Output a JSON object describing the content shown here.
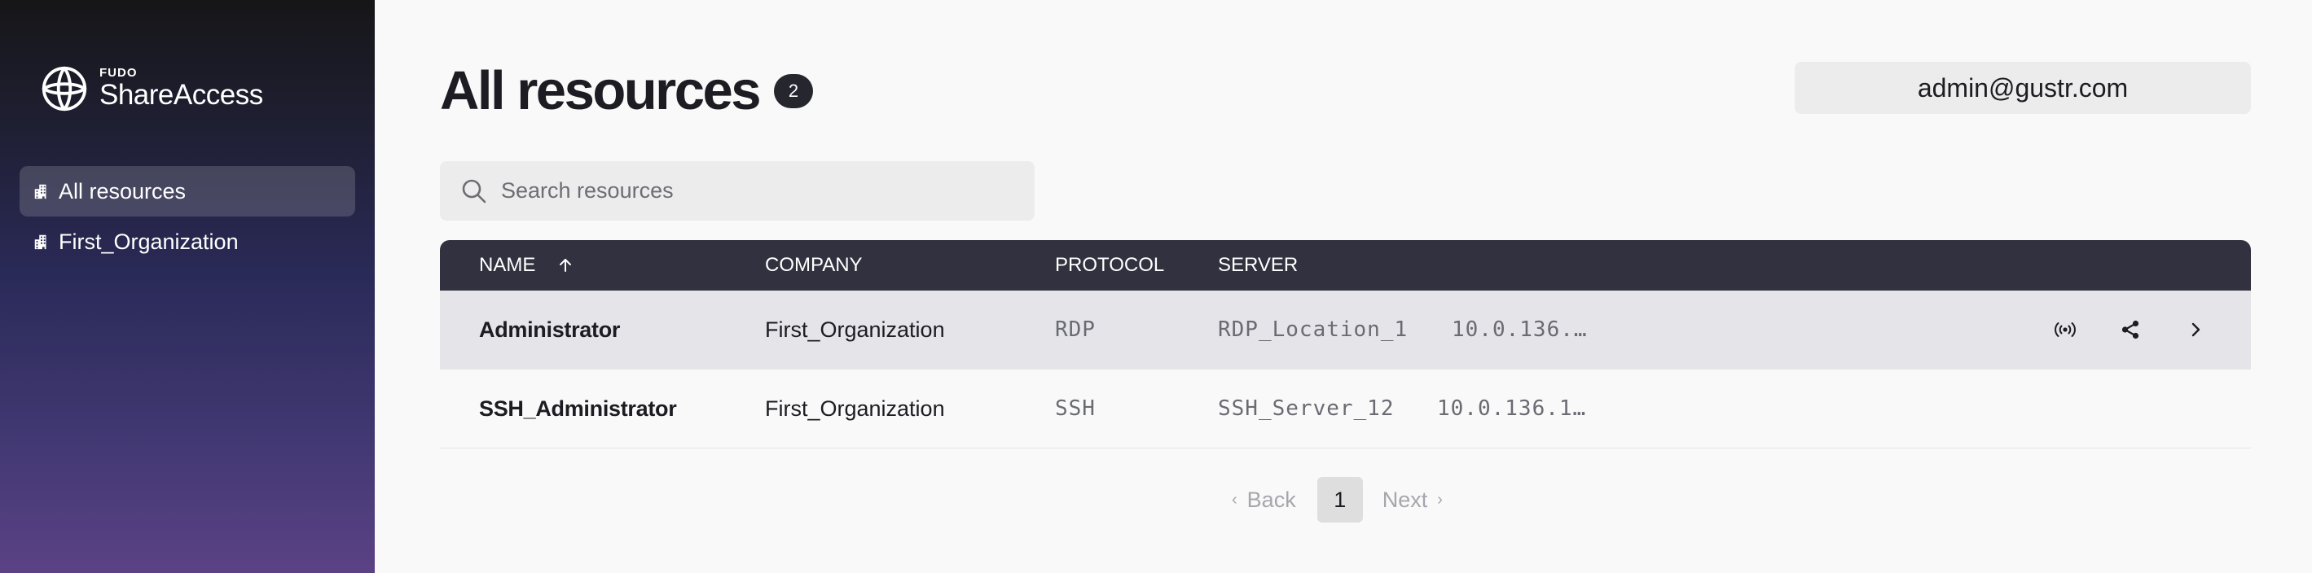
{
  "sidebar": {
    "logo": {
      "small": "FUDO",
      "name": "ShareAccess"
    },
    "items": [
      {
        "label": "All resources",
        "icon": "building-icon",
        "active": true
      },
      {
        "label": "First_Organization",
        "icon": "building-icon",
        "active": false
      }
    ]
  },
  "header": {
    "title": "All resources",
    "count": "2",
    "user": "admin@gustr.com"
  },
  "search": {
    "placeholder": "Search resources",
    "value": ""
  },
  "table": {
    "columns": {
      "name": "NAME",
      "company": "COMPANY",
      "protocol": "PROTOCOL",
      "server": "SERVER"
    },
    "sort": {
      "column": "NAME",
      "direction": "ascending"
    },
    "rows": [
      {
        "name": "Administrator",
        "company": "First_Organization",
        "protocol": "RDP",
        "server": "RDP_Location_1",
        "address": "10.0.136.…",
        "selected": true,
        "actions": [
          "connect-icon",
          "share-icon",
          "chevron-right-icon"
        ]
      },
      {
        "name": "SSH_Administrator",
        "company": "First_Organization",
        "protocol": "SSH",
        "server": "SSH_Server_12",
        "address": "10.0.136.1…",
        "selected": false,
        "actions": []
      }
    ]
  },
  "pagination": {
    "back": "Back",
    "current": "1",
    "next": "Next"
  },
  "colors": {
    "header_bg": "#31313f",
    "selected_row": "#e5e5e9",
    "badge": "#26262e",
    "sidebar_gradient": [
      "#161618",
      "#2a2a58",
      "#5b4285"
    ]
  }
}
